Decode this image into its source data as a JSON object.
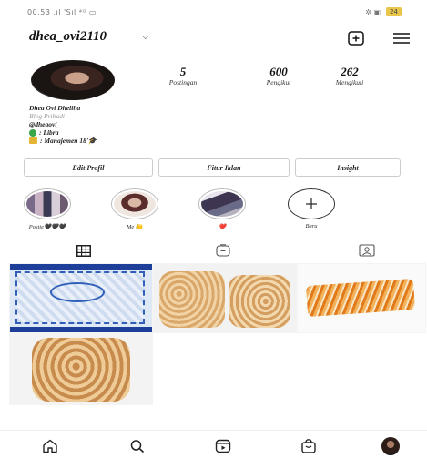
{
  "status_bar": {
    "time": "00.53 .ıl 'Sıl ⁴ᴳ ▭",
    "right_icons": "✲ ▣",
    "battery": "24"
  },
  "profile": {
    "username": "dhea_ovi2110",
    "stats": [
      {
        "value": "5",
        "label": "Postingan"
      },
      {
        "value": "600",
        "label": "Pengikut"
      },
      {
        "value": "262",
        "label": "Mengikuti"
      }
    ],
    "bio": {
      "name": "Dhea Ovi Dheliha",
      "category": "Blog Pribadi",
      "handle": "@dheaovi_",
      "line1": ": Libra",
      "line2": ": Manajemen 18'🎓"
    }
  },
  "buttons": {
    "edit_profile": "Edit Profil",
    "ad_tools": "Fitur Iklan",
    "insights": "Insight"
  },
  "highlights": [
    {
      "label": "Postie🖤🖤🖤"
    },
    {
      "label": "Me 🍋"
    },
    {
      "label": "❤️"
    },
    {
      "label": "Baru"
    }
  ],
  "colors": {
    "accent_text": "#111111",
    "border": "#cccccc",
    "bio_category": "#999999"
  }
}
